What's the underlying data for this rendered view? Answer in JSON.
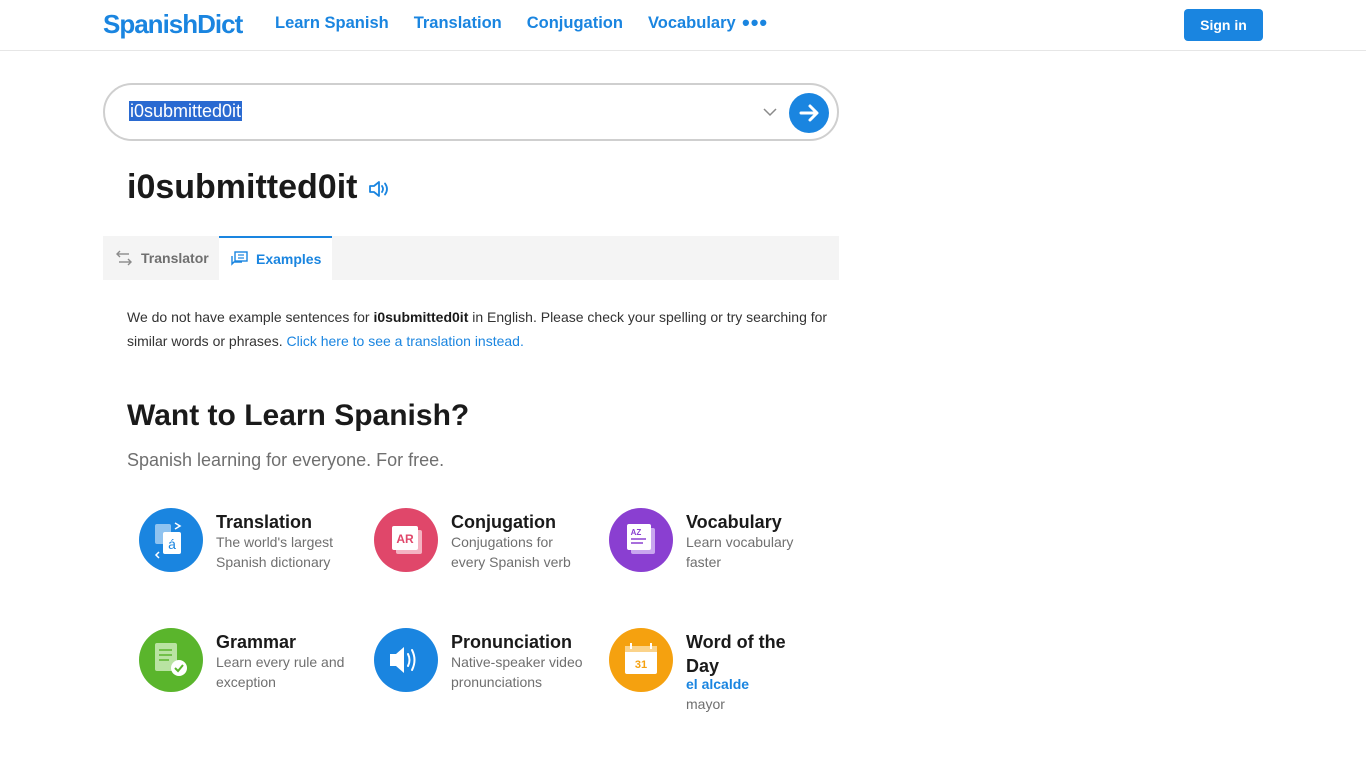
{
  "header": {
    "logo": "SpanishDict",
    "nav": [
      "Learn Spanish",
      "Translation",
      "Conjugation",
      "Vocabulary"
    ],
    "more_label": "•••",
    "signin_label": "Sign in"
  },
  "search": {
    "value": "i0submitted0it"
  },
  "entry": {
    "title": "i0submitted0it"
  },
  "tabs": {
    "translator": "Translator",
    "examples": "Examples"
  },
  "message": {
    "prefix": "We do not have example sentences for ",
    "term": "i0submitted0it",
    "suffix": " in English. Please check your spelling or try searching for similar words or phrases. ",
    "link": "Click here to see a translation instead."
  },
  "learn": {
    "title": "Want to Learn Spanish?",
    "subtitle": "Spanish learning for everyone. For free.",
    "features": [
      {
        "title": "Translation",
        "desc": "The world's largest Spanish dictionary",
        "icon": "translation-icon",
        "color": "#1a85e0"
      },
      {
        "title": "Conjugation",
        "desc": "Conjugations for every Spanish verb",
        "icon": "conjugation-icon",
        "color": "#e0476a"
      },
      {
        "title": "Vocabulary",
        "desc": "Learn vocabulary faster",
        "icon": "vocabulary-icon",
        "color": "#8a3fd1"
      },
      {
        "title": "Grammar",
        "desc": "Learn every rule and exception",
        "icon": "grammar-icon",
        "color": "#5ab52c"
      },
      {
        "title": "Pronunciation",
        "desc": "Native-speaker video pronunciations",
        "icon": "pronunciation-icon",
        "color": "#1a85e0"
      },
      {
        "title": "Word of the Day",
        "desc": "",
        "icon": "calendar-icon",
        "color": "#f5a10f",
        "word": "el alcalde",
        "meaning": "mayor",
        "day": "31"
      }
    ]
  },
  "colors": {
    "accent": "#1a85e0"
  }
}
